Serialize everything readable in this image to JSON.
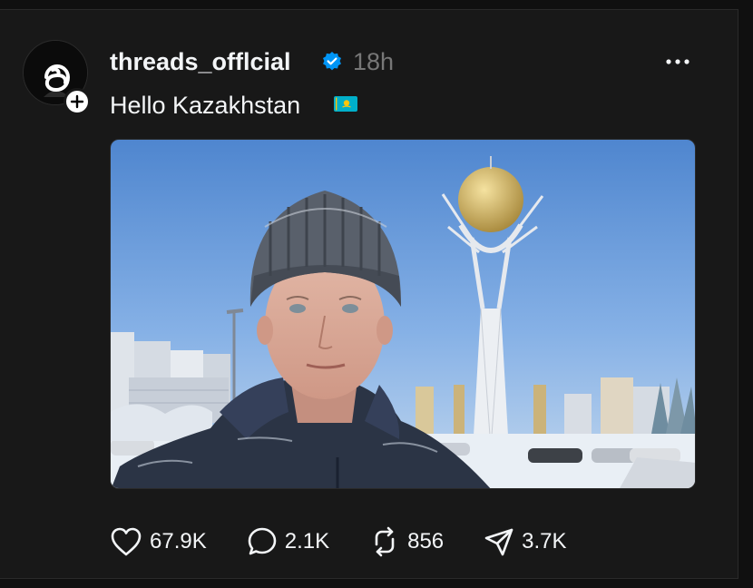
{
  "post": {
    "username": "threads_offlcial",
    "timestamp": "18h",
    "text": "Hello Kazakhstan",
    "flag_icon": "kazakhstan-flag-emoji",
    "verified": true,
    "image": {
      "subject": "selfie-knit-hat-bayterek-tower-snow"
    },
    "actions": {
      "likes": "67.9K",
      "replies": "2.1K",
      "reposts": "856",
      "shares": "3.7K"
    }
  },
  "colors": {
    "background": "#101010",
    "card": "#181818",
    "text": "#f3f5f7",
    "muted": "#777777",
    "verified": "#0095f6",
    "flag": "#00afca",
    "flag_sun": "#fec50c"
  },
  "icons": {
    "avatar": "threads-logo-icon",
    "follow": "plus-icon",
    "more": "more-horizontal-icon",
    "like": "heart-icon",
    "reply": "comment-icon",
    "repost": "repost-icon",
    "share": "send-icon"
  }
}
